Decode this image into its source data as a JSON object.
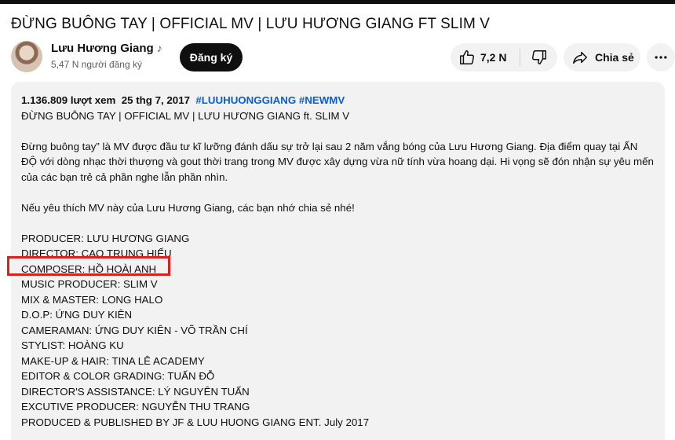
{
  "video": {
    "title": "ĐỪNG BUÔNG TAY | OFFICIAL MV | LƯU HƯƠNG GIANG FT SLIM V"
  },
  "channel": {
    "name": "Lưu Hương Giang",
    "badge_icon": "music-note-icon",
    "subscribers": "5,47 N người đăng ký"
  },
  "actions": {
    "subscribe_label": "Đăng ký",
    "like_count": "7,2 N",
    "share_label": "Chia sẻ"
  },
  "description": {
    "views": "1.136.809 lượt xem",
    "date": "25 thg 7, 2017",
    "hashtags": "#LUUHUONGGIANG #NEWMV",
    "title_line": "ĐỪNG BUÔNG TAY | OFFICIAL MV | LƯU HƯƠNG GIANG ft. SLIM V",
    "paragraph1_line1": "Đừng buông tay” là MV được đầu tư kĩ lưỡng đánh dấu sự trở lại sau 2 năm vắng bóng của Lưu Hương Giang. Địa điểm quay tại ẤN",
    "paragraph1_line2": "ĐỘ với dòng nhạc thời thượng và gout thời trang trong MV được xây dựng vừa nữ tính vừa hoang dại. Hi vọng sẽ đón nhận sự yêu mến",
    "paragraph1_line3": "của các bạn trẻ cả phần nghe lẫn phần nhìn.",
    "paragraph2": "Nếu yêu thích MV này của Lưu Hương Giang, các bạn nhớ chia sẻ nhé!",
    "credits": [
      "PRODUCER: LƯU HƯƠNG GIANG",
      "DIRECTOR: CAO TRUNG HIẾU",
      "COMPOSER: HỒ HOÀI ANH",
      "MUSIC PRODUCER: SLIM V",
      "MIX & MASTER: LONG HALO",
      "D.O.P: ỨNG DUY KIÊN",
      "CAMERAMAN: ỨNG DUY KIÊN - VÕ TRẦN CHÍ",
      "STYLIST: HOÀNG KU",
      "MAKE-UP & HAIR: TINA LÊ ACADEMY",
      "EDITOR & COLOR GRADING: TUẤN ĐỖ",
      "DIRECTOR'S ASSISTANCE: LÝ NGUYÊN TUẤN",
      "EXCUTIVE PRODUCER: NGUYỄN THU TRANG",
      "PRODUCED & PUBLISHED BY JF & LUU HUONG GIANG ENT. July 2017"
    ]
  },
  "colors": {
    "hashtag": "#065fd4",
    "highlight": "#e01e1e",
    "button_bg": "#f2f2f2",
    "subscribe_bg": "#0f0f0f"
  }
}
